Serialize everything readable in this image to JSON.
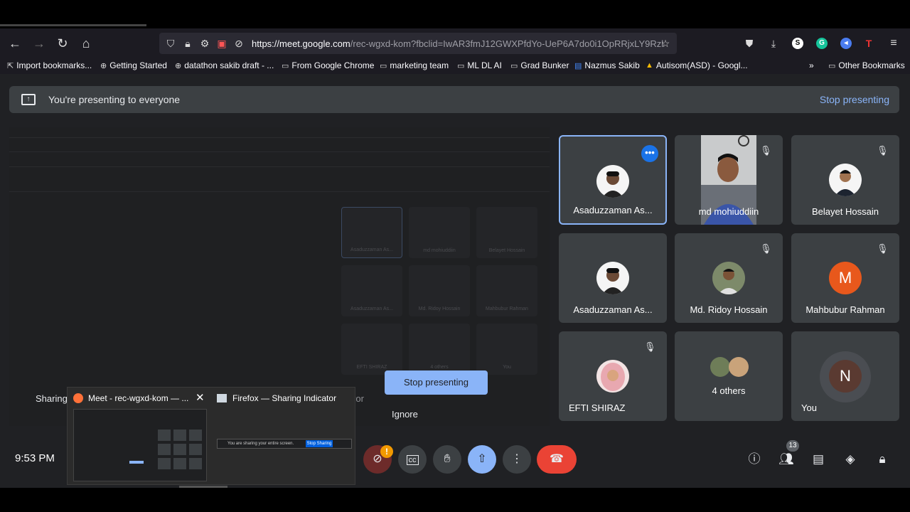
{
  "browser": {
    "url_host": "https://meet.google.com",
    "url_path": "/rec-wgxd-kom?fbclid=IwAR3fmJ12GWXPfdYo-UeP6A7do0i1OpRRjxLY9Rzl",
    "bookmarks": [
      {
        "label": "Import bookmarks...",
        "icon": "import-icon"
      },
      {
        "label": "Getting Started",
        "icon": "globe-icon"
      },
      {
        "label": "datathon sakib draft - ...",
        "icon": "globe-icon"
      },
      {
        "label": "From Google Chrome",
        "icon": "folder-icon"
      },
      {
        "label": "marketing team",
        "icon": "folder-icon"
      },
      {
        "label": "ML DL AI",
        "icon": "folder-icon"
      },
      {
        "label": "Grad Bunker",
        "icon": "folder-icon"
      },
      {
        "label": "Nazmus Sakib",
        "icon": "doc-icon"
      },
      {
        "label": "Autisom(ASD) - Googl...",
        "icon": "drive-icon"
      }
    ],
    "overflow_label": "»",
    "other_bookmarks": "Other Bookmarks"
  },
  "meet": {
    "banner_text": "You're presenting to everyone",
    "banner_stop": "Stop presenting",
    "participants": [
      {
        "name": "Asaduzzaman As...",
        "muted": false,
        "active": true
      },
      {
        "name": "md mohiuddiin",
        "muted": true,
        "active": false
      },
      {
        "name": "Belayet Hossain",
        "muted": true,
        "active": false
      },
      {
        "name": "Asaduzzaman As...",
        "muted": false,
        "active": false
      },
      {
        "name": "Md. Ridoy Hossain",
        "muted": true,
        "active": false
      },
      {
        "name": "Mahbubur Rahman",
        "muted": true,
        "active": false,
        "letter": "M",
        "color": "#e8581c"
      },
      {
        "name": "EFTI SHIRAZ",
        "muted": true,
        "active": false
      },
      {
        "name": "4 others",
        "muted": false,
        "active": false
      },
      {
        "name": "You",
        "muted": false,
        "active": false,
        "letter": "N",
        "color": "#5a3a31"
      }
    ],
    "stop_presenting_button": "Stop presenting",
    "ignore_label": "Ignore",
    "sharing_text": "Sharing",
    "mirror_text": "mirror",
    "clock": "9:53 PM",
    "participant_count": "13",
    "accent": "#8ab4f8",
    "hangup_color": "#ea4335"
  },
  "taskbar_popup": {
    "item1_title": "Meet - rec-wgxd-kom — ...",
    "item2_title": "Firefox — Sharing Indicator",
    "item2_preview_text": "You are sharing your entire screen.",
    "item2_preview_button": "Stop Sharing"
  }
}
